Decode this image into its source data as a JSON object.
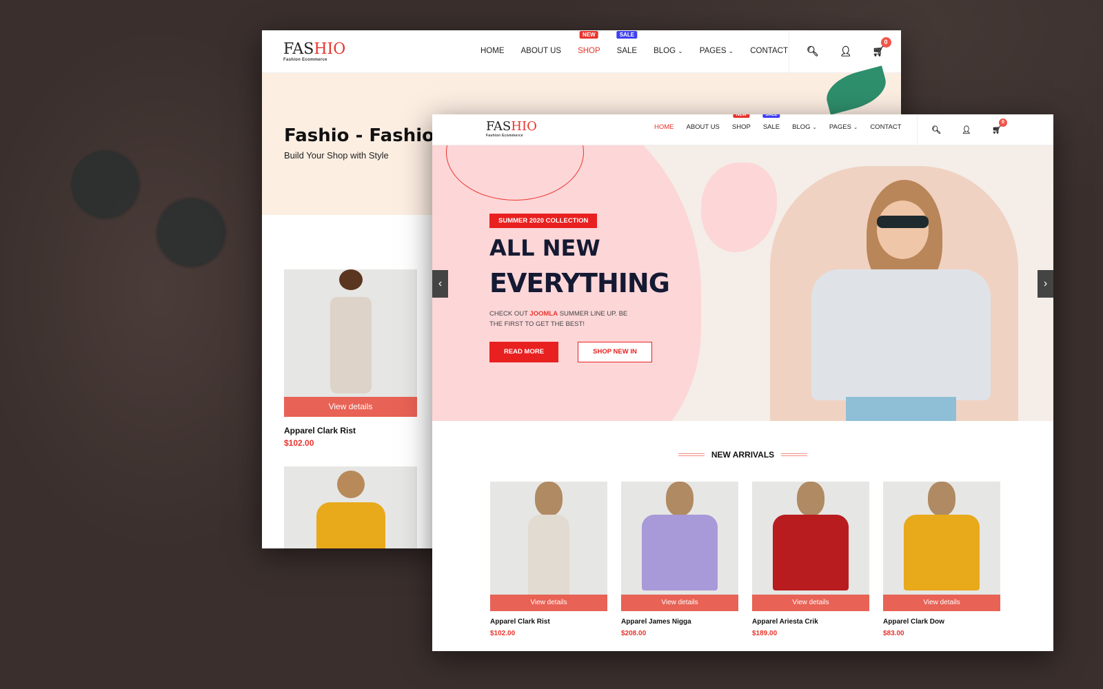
{
  "back": {
    "logo": {
      "main_a": "FAS",
      "main_b": "HIO",
      "tagline": "Fashion Ecommerce"
    },
    "menu": [
      {
        "label": "HOME"
      },
      {
        "label": "ABOUT US"
      },
      {
        "label": "SHOP",
        "badge": "NEW",
        "active": true
      },
      {
        "label": "SALE",
        "badge": "SALE"
      },
      {
        "label": "BLOG",
        "dropdown": true
      },
      {
        "label": "PAGES",
        "dropdown": true
      },
      {
        "label": "CONTACT"
      }
    ],
    "cart_count": "0",
    "hero_title": "Fashio - Fashion S",
    "hero_subtitle": "Build Your Shop with Style",
    "product": {
      "name": "Apparel Clark Rist",
      "price": "$102.00",
      "cta": "View details"
    }
  },
  "front": {
    "logo": {
      "main_a": "FAS",
      "main_b": "HIO",
      "tagline": "Fashion Ecommerce"
    },
    "menu": [
      {
        "label": "HOME",
        "active": true
      },
      {
        "label": "ABOUT US"
      },
      {
        "label": "SHOP",
        "badge": "NEW"
      },
      {
        "label": "SALE",
        "badge": "SALE"
      },
      {
        "label": "BLOG",
        "dropdown": true
      },
      {
        "label": "PAGES",
        "dropdown": true
      },
      {
        "label": "CONTACT"
      }
    ],
    "cart_count": "0",
    "hero": {
      "tag": "SUMMER 2020 COLLECTION",
      "title_1": "ALL NEW",
      "title_2": "EVERYTHING",
      "desc_a": "CHECK OUT ",
      "desc_highlight": "JOOMLA",
      "desc_b": " SUMMER LINE UP. BE THE FIRST TO GET THE BEST!",
      "read_more": "READ MORE",
      "shop_new": "SHOP NEW IN",
      "prev_icon": "chevron-left-icon",
      "next_icon": "chevron-right-icon"
    },
    "section_title": "NEW ARRIVALS",
    "products": [
      {
        "name": "Apparel Clark Rist",
        "price": "$102.00",
        "cta": "View details",
        "color": "#e2dbd2"
      },
      {
        "name": "Apparel James Nigga",
        "price": "$208.00",
        "cta": "View details",
        "color": "#a899d8"
      },
      {
        "name": "Apparel Ariesta Crik",
        "price": "$189.00",
        "cta": "View details",
        "color": "#b81c1f"
      },
      {
        "name": "Apparel Clark Dow",
        "price": "$83.00",
        "cta": "View details",
        "color": "#e8a91b"
      }
    ]
  },
  "colors": {
    "accent": "#e8332c",
    "sale_badge": "#3d3ff0",
    "view_details": "#e85041",
    "hero_pink": "#fdd6d8",
    "back_hero": "#fdeee2",
    "dark_text": "#151a33"
  }
}
